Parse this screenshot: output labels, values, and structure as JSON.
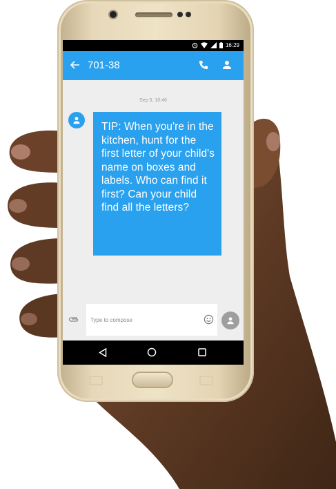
{
  "status_bar": {
    "time": "16:29",
    "icons": [
      "alarm-icon",
      "wifi-icon",
      "signal-icon",
      "battery-icon"
    ]
  },
  "app_bar": {
    "title": "701-38",
    "icons": [
      "back-arrow-icon",
      "phone-icon",
      "contact-icon"
    ]
  },
  "conversation": {
    "timestamp": "Sep 5, 10:46",
    "messages": [
      {
        "text": "TIP: When you're in the kitchen, hunt for the first letter of your child's name on boxes and labels. Who can find it first? Can your child find all the letters?"
      }
    ]
  },
  "compose": {
    "placeholder": "Type to compose",
    "icons": [
      "paperclip-icon",
      "emoji-icon",
      "send-icon"
    ]
  },
  "navigation": {
    "icons": [
      "nav-back-icon",
      "nav-home-icon",
      "nav-recents-icon"
    ]
  },
  "colors": {
    "accent": "#2aa1ee",
    "screen_bg": "#eeeeee",
    "phone_gold": "#e6d8b8"
  }
}
